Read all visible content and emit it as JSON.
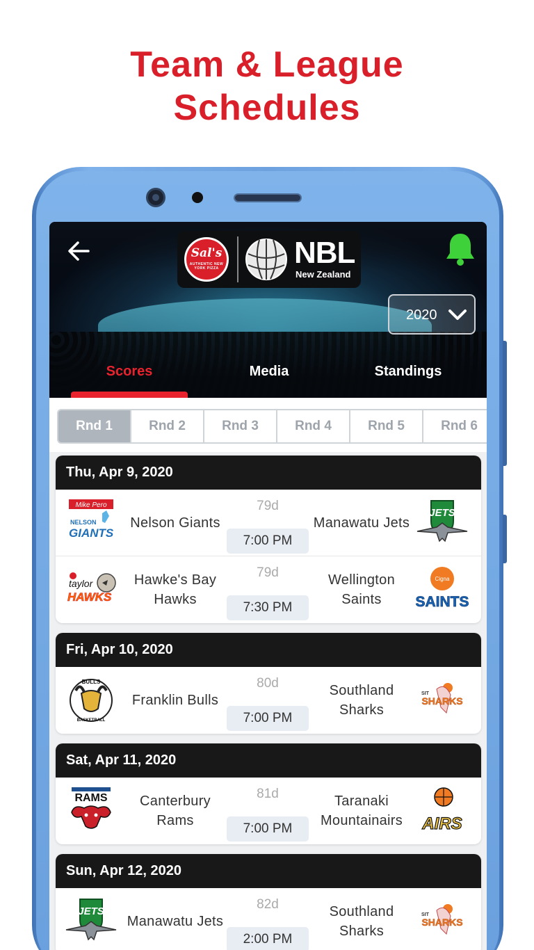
{
  "headline": {
    "line1": "Team & League",
    "line2": "Schedules"
  },
  "colors": {
    "accent": "#d81f2a",
    "tab_active": "#e8232e",
    "bell": "#3fd13a"
  },
  "header": {
    "back_icon": "arrow-left-icon",
    "notification_icon": "bell-icon",
    "sponsor_logo": {
      "brand": "Sal's",
      "sub": "AUTHENTIC NEW YORK PIZZA"
    },
    "league_logo": {
      "name": "NBL",
      "sub": "New Zealand"
    },
    "season": "2020"
  },
  "tabs": [
    {
      "label": "Scores",
      "active": true
    },
    {
      "label": "Media",
      "active": false
    },
    {
      "label": "Standings",
      "active": false
    }
  ],
  "rounds": [
    {
      "label": "Rnd 1",
      "active": true
    },
    {
      "label": "Rnd 2",
      "active": false
    },
    {
      "label": "Rnd 3",
      "active": false
    },
    {
      "label": "Rnd 4",
      "active": false
    },
    {
      "label": "Rnd 5",
      "active": false
    },
    {
      "label": "Rnd 6",
      "active": false
    }
  ],
  "schedule": [
    {
      "date": "Thu, Apr 9, 2020",
      "games": [
        {
          "home": "Nelson Giants",
          "away": "Manawatu Jets",
          "countdown": "79d",
          "time": "7:00 PM"
        },
        {
          "home": "Hawke's Bay Hawks",
          "away": "Wellington Saints",
          "countdown": "79d",
          "time": "7:30 PM"
        }
      ]
    },
    {
      "date": "Fri, Apr 10, 2020",
      "games": [
        {
          "home": "Franklin Bulls",
          "away": "Southland Sharks",
          "countdown": "80d",
          "time": "7:00 PM"
        }
      ]
    },
    {
      "date": "Sat, Apr 11, 2020",
      "games": [
        {
          "home": "Canterbury Rams",
          "away": "Taranaki Mountainairs",
          "countdown": "81d",
          "time": "7:00 PM"
        }
      ]
    },
    {
      "date": "Sun, Apr 12, 2020",
      "games": [
        {
          "home": "Manawatu Jets",
          "away": "Southland Sharks",
          "countdown": "82d",
          "time": "2:00 PM"
        }
      ]
    }
  ],
  "team_logos": {
    "nelson": {
      "top": "Mike Pero",
      "main": "NELSON",
      "sub": "GIANTS"
    },
    "jets": {
      "main": "JETS"
    },
    "hawks": {
      "top": "taylor",
      "main": "HAWKS"
    },
    "saints": {
      "top": "Cigna",
      "main": "SAINTS"
    },
    "bulls": {
      "top": "BULLS",
      "sub": "BASKETBALL"
    },
    "sharks": {
      "top": "SIT",
      "main": "SHARKS"
    },
    "rams": {
      "main": "RAMS"
    },
    "airs": {
      "main": "AIRS"
    }
  }
}
